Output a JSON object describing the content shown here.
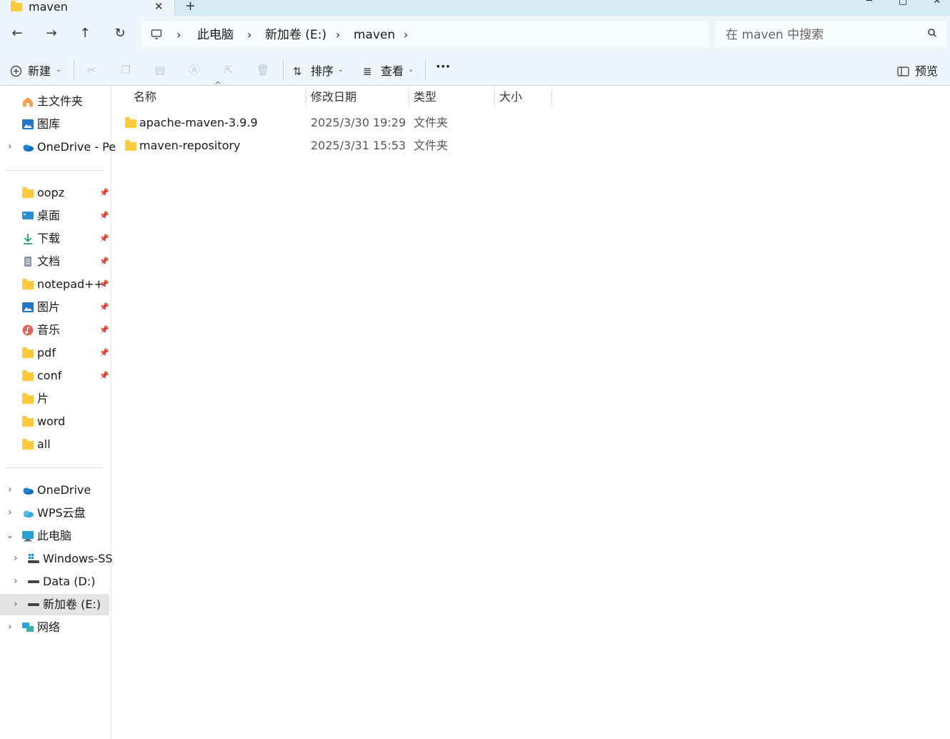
{
  "tab": {
    "title": "maven",
    "close_glyph": "✕",
    "new_glyph": "+"
  },
  "window": {
    "min_glyph": "─",
    "max_glyph": "□",
    "close_glyph": "✕"
  },
  "nav": {
    "back_glyph": "←",
    "forward_glyph": "→",
    "up_glyph": "↑",
    "refresh_glyph": "↻"
  },
  "breadcrumb": {
    "items": [
      "此电脑",
      "新加卷 (E:)",
      "maven"
    ],
    "separator": "›"
  },
  "search": {
    "placeholder": "在 maven 中搜索"
  },
  "commands": {
    "new_label": "新建",
    "sort_label": "排序",
    "view_label": "查看",
    "more_label": "···",
    "preview_label": "预览"
  },
  "sidebar": {
    "quick": [
      {
        "label": "主文件夹",
        "icon": "home-icon"
      },
      {
        "label": "图库",
        "icon": "gallery-icon"
      },
      {
        "label": "OneDrive - Pe",
        "icon": "onedrive-icon",
        "expandable": true
      }
    ],
    "pinned": [
      {
        "label": "oopz",
        "icon": "folder-icon",
        "pinned": true
      },
      {
        "label": "桌面",
        "icon": "desktop-icon",
        "pinned": true
      },
      {
        "label": "下载",
        "icon": "download-icon",
        "pinned": true
      },
      {
        "label": "文档",
        "icon": "document-icon",
        "pinned": true
      },
      {
        "label": "notepad++",
        "icon": "folder-icon",
        "pinned": true
      },
      {
        "label": "图片",
        "icon": "pictures-icon",
        "pinned": true
      },
      {
        "label": "音乐",
        "icon": "music-icon",
        "pinned": true
      },
      {
        "label": "pdf",
        "icon": "folder-icon",
        "pinned": true
      },
      {
        "label": "conf",
        "icon": "folder-icon",
        "pinned": true
      },
      {
        "label": "片",
        "icon": "folder-icon",
        "pinned": false
      },
      {
        "label": "word",
        "icon": "folder-icon",
        "pinned": false
      },
      {
        "label": "all",
        "icon": "folder-icon",
        "pinned": false
      }
    ],
    "tree": [
      {
        "label": "OneDrive",
        "icon": "onedrive-icon",
        "expand": "›"
      },
      {
        "label": "WPS云盘",
        "icon": "wps-cloud-icon",
        "expand": "›"
      },
      {
        "label": "此电脑",
        "icon": "computer-icon",
        "expand": "⌄"
      },
      {
        "label": "Windows-SS",
        "icon": "windows-drive-icon",
        "expand": "›",
        "indent": true
      },
      {
        "label": "Data (D:)",
        "icon": "drive-icon",
        "expand": "›",
        "indent": true
      },
      {
        "label": "新加卷 (E:)",
        "icon": "drive-icon",
        "expand": "›",
        "indent": true,
        "selected": true
      },
      {
        "label": "网络",
        "icon": "network-icon",
        "expand": "›"
      }
    ]
  },
  "columns": {
    "name": "名称",
    "modified": "修改日期",
    "type": "类型",
    "size": "大小",
    "sort_glyph": "^"
  },
  "files": [
    {
      "name": "apache-maven-3.9.9",
      "modified": "2025/3/30 19:29",
      "type": "文件夹"
    },
    {
      "name": "maven-repository",
      "modified": "2025/3/31 15:53",
      "type": "文件夹"
    }
  ],
  "colors": {
    "folder": "#ffc93c",
    "chrome_bg": "#eef6fc",
    "tabstrip_bg": "#d7ebf7",
    "selection": "#e5e5e5"
  }
}
